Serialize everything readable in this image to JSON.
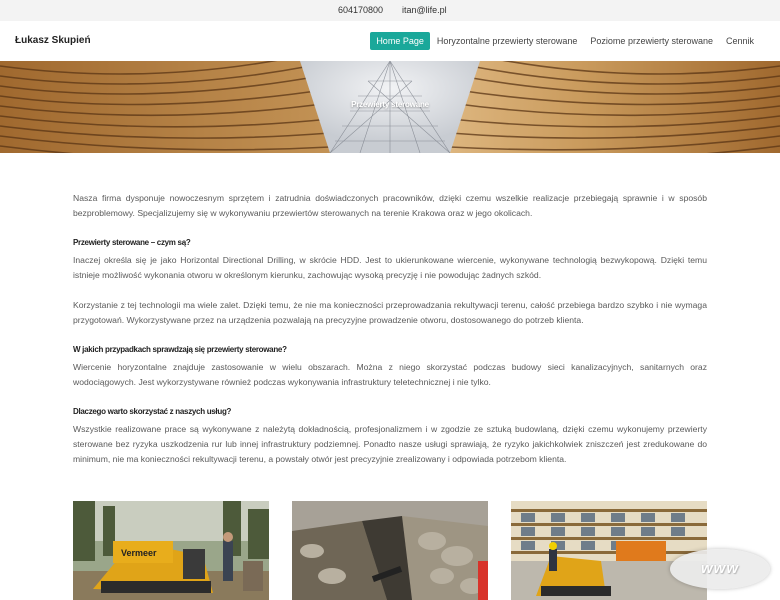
{
  "topbar": {
    "phone": "604170800",
    "email": "itan@life.pl"
  },
  "header": {
    "brand": "Łukasz Skupień",
    "nav": [
      {
        "label": "Home Page",
        "active": true
      },
      {
        "label": "Horyzontalne przewierty sterowane",
        "active": false
      },
      {
        "label": "Poziome przewierty sterowane",
        "active": false
      },
      {
        "label": "Cennik",
        "active": false
      }
    ]
  },
  "hero": {
    "title": "Przewierty sterowane"
  },
  "content": {
    "intro": "Nasza firma dysponuje nowoczesnym sprzętem i zatrudnia doświadczonych pracowników, dzięki czemu wszelkie realizacje przebiegają sprawnie i w sposób bezproblemowy. Specjalizujemy się w wykonywaniu przewiertów sterowanych na terenie Krakowa oraz w jego okolicach.",
    "section1_heading": "Przewierty sterowane – czym są?",
    "section1_p1": "Inaczej określa się je jako Horizontal Directional Drilling, w skrócie HDD. Jest to ukierunkowane wiercenie, wykonywane technologią bezwykopową. Dzięki temu istnieje możliwość wykonania otworu w określonym kierunku, zachowując wysoką precyzję i nie powodując żadnych szkód.",
    "section1_p2": "Korzystanie z tej technologii ma wiele zalet. Dzięki temu, że nie ma konieczności przeprowadzania rekultywacji terenu, całość przebiega bardzo szybko i nie wymaga przygotowań. Wykorzystywane przez na urządzenia pozwalają na precyzyjne prowadzenie otworu, dostosowanego do potrzeb klienta.",
    "section2_heading": "W jakich przypadkach sprawdzają się przewierty sterowane?",
    "section2_p1": "Wiercenie horyzontalne znajduje zastosowanie w wielu obszarach. Można z niego skorzystać podczas budowy sieci kanalizacyjnych, sanitarnych oraz wodociągowych. Jest wykorzystywane również podczas wykonywania infrastruktury teletechnicznej i nie tylko.",
    "section3_heading": "Dlaczego warto skorzystać z naszych usług?",
    "section3_p1": "Wszystkie realizowane prace są wykonywane z należytą dokładnością, profesjonalizmem i w zgodzie ze sztuką budowlaną, dzięki czemu wykonujemy przewierty sterowane bez ryzyka uszkodzenia rur lub innej infrastruktury podziemnej. Ponadto nasze usługi sprawiają, że ryzyko jakichkolwiek zniszczeń jest zredukowane do minimum, nie ma konieczności rekultywacji terenu, a powstały otwór jest precyzyjnie zrealizowany i odpowiada potrzebom klienta."
  },
  "gallery": [
    {
      "name": "drilling-rig-photo",
      "machine_text": "Vermeer"
    },
    {
      "name": "trench-pipe-photo"
    },
    {
      "name": "site-building-photo"
    }
  ],
  "badge": {
    "text": "www"
  },
  "colors": {
    "accent": "#1aa89a",
    "topbar_bg": "#f3f3f3"
  }
}
